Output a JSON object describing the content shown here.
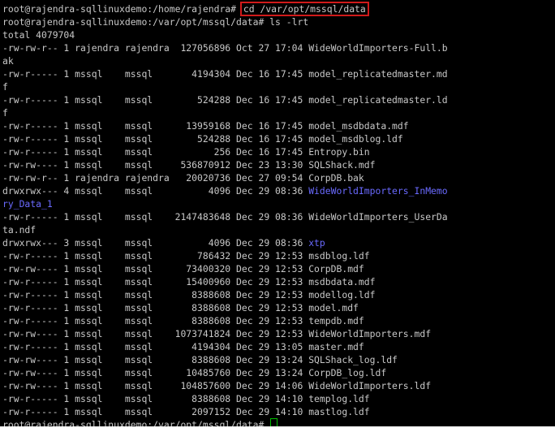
{
  "colors": {
    "background": "#000000",
    "text": "#c8c8c8",
    "directory": "#6a6aff",
    "highlight_box": "#d11a1a",
    "cursor": "#00c000"
  },
  "line1": {
    "prompt": "root@rajendra-sqllinuxdemo:/home/rajendra# ",
    "command": "cd /var/opt/mssql/data"
  },
  "line2": {
    "prompt": "root@rajendra-sqllinuxdemo:/var/opt/mssql/data# ",
    "command": "ls -lrt"
  },
  "total": "total 4079704",
  "entries": [
    {
      "perms": "-rw-rw-r--",
      "links": "1",
      "owner": "rajendra",
      "group": "rajendra",
      "size": "127056896",
      "date": "Oct 27 17:04",
      "name": "WideWorldImporters-Full.b",
      "cont": "ak",
      "is_dir": false
    },
    {
      "perms": "-rw-r-----",
      "links": "1",
      "owner": "mssql",
      "group": "mssql",
      "size": "4194304",
      "date": "Dec 16 17:45",
      "name": "model_replicatedmaster.md",
      "cont": "f",
      "is_dir": false
    },
    {
      "perms": "-rw-r-----",
      "links": "1",
      "owner": "mssql",
      "group": "mssql",
      "size": "524288",
      "date": "Dec 16 17:45",
      "name": "model_replicatedmaster.ld",
      "cont": "f",
      "is_dir": false
    },
    {
      "perms": "-rw-r-----",
      "links": "1",
      "owner": "mssql",
      "group": "mssql",
      "size": "13959168",
      "date": "Dec 16 17:45",
      "name": "model_msdbdata.mdf",
      "is_dir": false
    },
    {
      "perms": "-rw-r-----",
      "links": "1",
      "owner": "mssql",
      "group": "mssql",
      "size": "524288",
      "date": "Dec 16 17:45",
      "name": "model_msdblog.ldf",
      "is_dir": false
    },
    {
      "perms": "-rw-r-----",
      "links": "1",
      "owner": "mssql",
      "group": "mssql",
      "size": "256",
      "date": "Dec 16 17:45",
      "name": "Entropy.bin",
      "is_dir": false
    },
    {
      "perms": "-rw-rw----",
      "links": "1",
      "owner": "mssql",
      "group": "mssql",
      "size": "536870912",
      "date": "Dec 23 13:30",
      "name": "SQLShack.mdf",
      "is_dir": false
    },
    {
      "perms": "-rw-rw-r--",
      "links": "1",
      "owner": "rajendra",
      "group": "rajendra",
      "size": "20020736",
      "date": "Dec 27 09:54",
      "name": "CorpDB.bak",
      "is_dir": false
    },
    {
      "perms": "drwxrwx---",
      "links": "4",
      "owner": "mssql",
      "group": "mssql",
      "size": "4096",
      "date": "Dec 29 08:36",
      "name": "WideWorldImporters_InMemo",
      "cont": "ry_Data_1",
      "is_dir": true
    },
    {
      "perms": "-rw-r-----",
      "links": "1",
      "owner": "mssql",
      "group": "mssql",
      "size": "2147483648",
      "date": "Dec 29 08:36",
      "name": "WideWorldImporters_UserDa",
      "cont": "ta.ndf",
      "is_dir": false
    },
    {
      "perms": "drwxrwx---",
      "links": "3",
      "owner": "mssql",
      "group": "mssql",
      "size": "4096",
      "date": "Dec 29 08:36",
      "name": "xtp",
      "is_dir": true
    },
    {
      "perms": "-rw-r-----",
      "links": "1",
      "owner": "mssql",
      "group": "mssql",
      "size": "786432",
      "date": "Dec 29 12:53",
      "name": "msdblog.ldf",
      "is_dir": false
    },
    {
      "perms": "-rw-rw----",
      "links": "1",
      "owner": "mssql",
      "group": "mssql",
      "size": "73400320",
      "date": "Dec 29 12:53",
      "name": "CorpDB.mdf",
      "is_dir": false
    },
    {
      "perms": "-rw-r-----",
      "links": "1",
      "owner": "mssql",
      "group": "mssql",
      "size": "15400960",
      "date": "Dec 29 12:53",
      "name": "msdbdata.mdf",
      "is_dir": false
    },
    {
      "perms": "-rw-r-----",
      "links": "1",
      "owner": "mssql",
      "group": "mssql",
      "size": "8388608",
      "date": "Dec 29 12:53",
      "name": "modellog.ldf",
      "is_dir": false
    },
    {
      "perms": "-rw-r-----",
      "links": "1",
      "owner": "mssql",
      "group": "mssql",
      "size": "8388608",
      "date": "Dec 29 12:53",
      "name": "model.mdf",
      "is_dir": false
    },
    {
      "perms": "-rw-r-----",
      "links": "1",
      "owner": "mssql",
      "group": "mssql",
      "size": "8388608",
      "date": "Dec 29 12:53",
      "name": "tempdb.mdf",
      "is_dir": false
    },
    {
      "perms": "-rw-rw----",
      "links": "1",
      "owner": "mssql",
      "group": "mssql",
      "size": "1073741824",
      "date": "Dec 29 12:53",
      "name": "WideWorldImporters.mdf",
      "is_dir": false
    },
    {
      "perms": "-rw-r-----",
      "links": "1",
      "owner": "mssql",
      "group": "mssql",
      "size": "4194304",
      "date": "Dec 29 13:05",
      "name": "master.mdf",
      "is_dir": false
    },
    {
      "perms": "-rw-rw----",
      "links": "1",
      "owner": "mssql",
      "group": "mssql",
      "size": "8388608",
      "date": "Dec 29 13:24",
      "name": "SQLShack_log.ldf",
      "is_dir": false
    },
    {
      "perms": "-rw-rw----",
      "links": "1",
      "owner": "mssql",
      "group": "mssql",
      "size": "10485760",
      "date": "Dec 29 13:24",
      "name": "CorpDB_log.ldf",
      "is_dir": false
    },
    {
      "perms": "-rw-rw----",
      "links": "1",
      "owner": "mssql",
      "group": "mssql",
      "size": "104857600",
      "date": "Dec 29 14:06",
      "name": "WideWorldImporters.ldf",
      "is_dir": false
    },
    {
      "perms": "-rw-r-----",
      "links": "1",
      "owner": "mssql",
      "group": "mssql",
      "size": "8388608",
      "date": "Dec 29 14:10",
      "name": "templog.ldf",
      "is_dir": false
    },
    {
      "perms": "-rw-r-----",
      "links": "1",
      "owner": "mssql",
      "group": "mssql",
      "size": "2097152",
      "date": "Dec 29 14:10",
      "name": "mastlog.ldf",
      "is_dir": false
    }
  ],
  "final_prompt": "root@rajendra-sqllinuxdemo:/var/opt/mssql/data# "
}
